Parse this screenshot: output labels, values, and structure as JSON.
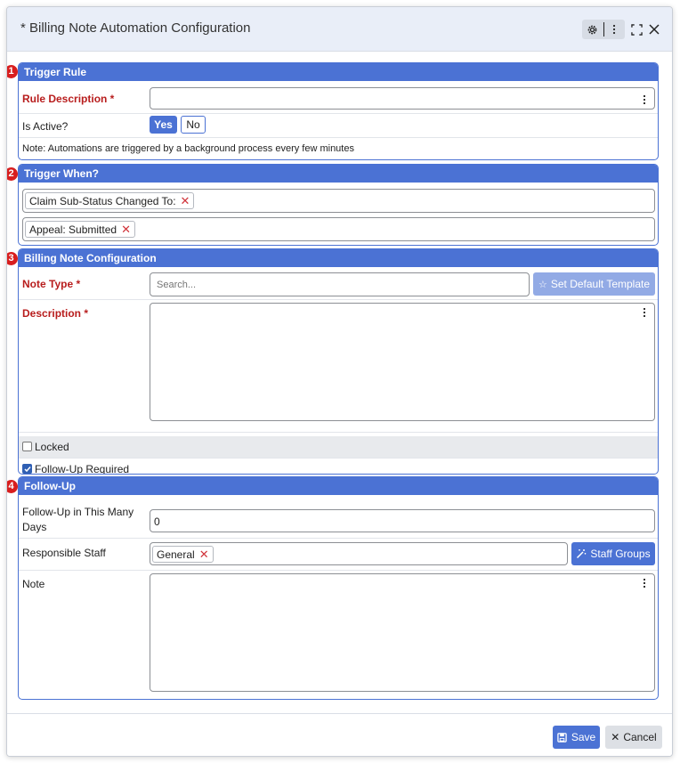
{
  "dialog": {
    "title": "* Billing Note Automation Configuration",
    "toolbar": {
      "settings_icon": "gear-icon",
      "menu_icon": "kebab-icon",
      "maximize_icon": "maximize-icon",
      "close_icon": "close-icon"
    }
  },
  "sections": {
    "trigger_rule": {
      "badge": "1",
      "heading": "Trigger Rule",
      "rule_description_label": "Rule Description *",
      "rule_description_value": "",
      "is_active_label": "Is Active?",
      "yes_label": "Yes",
      "no_label": "No",
      "is_active_selected": "Yes",
      "note": "Note: Automations are triggered by a background process every few minutes"
    },
    "trigger_when": {
      "badge": "2",
      "heading": "Trigger When?",
      "chips_row1": [
        "Claim Sub-Status Changed To:"
      ],
      "chips_row2": [
        "Appeal: Submitted"
      ]
    },
    "billing_note": {
      "badge": "3",
      "heading": "Billing Note Configuration",
      "note_type_label": "Note Type *",
      "note_type_placeholder": "Search...",
      "set_default_template_label": "Set Default Template",
      "description_label": "Description *",
      "locked_label": "Locked",
      "locked_checked": false,
      "follow_up_required_label": "Follow-Up Required",
      "follow_up_required_checked": true
    },
    "follow_up": {
      "badge": "4",
      "heading": "Follow-Up",
      "days_label_line1": "Follow-Up in This Many",
      "days_label_line2": "Days",
      "days_value": "0",
      "responsible_staff_label": "Responsible Staff",
      "staff_chips": [
        "General"
      ],
      "staff_groups_label": "Staff Groups",
      "note_label": "Note"
    }
  },
  "footer": {
    "save_label": "Save",
    "cancel_label": "Cancel"
  },
  "colors": {
    "accent": "#4b72d4",
    "badge": "#d81e1e",
    "required": "#b81d1d",
    "titlebar": "#e9eef8"
  }
}
